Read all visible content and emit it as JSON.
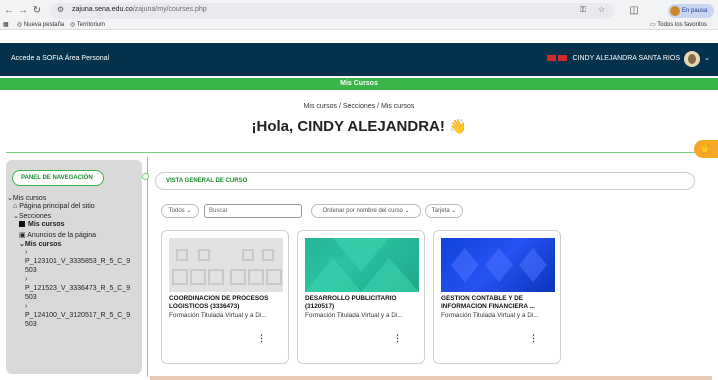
{
  "browser": {
    "url_host": "zajuna.sena.edu.co",
    "url_path": "/zajuna/my/courses.php",
    "pause_label": "En pausa",
    "bookmarks": [
      "Nueva pestaña",
      "Territorium"
    ],
    "all_bookmarks": "Todos los favoritos"
  },
  "header": {
    "left_links": "Accede a SOFIA   Área Personal",
    "user_name": "CINDY ALEJANDRA SANTA RIOS"
  },
  "banner": {
    "title": "Mis Cursos"
  },
  "breadcrumb": "Mis cursos / Secciones / Mis cursos",
  "greeting": "¡Hola, CINDY ALEJANDRA!",
  "wave_icon": "👋",
  "sidebar": {
    "panel_title": "PANEL DE NAVEGACIÓN",
    "items": [
      {
        "label": "Mis cursos"
      },
      {
        "label": "Página principal del sitio"
      },
      {
        "label": "Secciones"
      },
      {
        "label": "Mis cursos"
      },
      {
        "label": "Anuncios de la página"
      },
      {
        "label": "Mis cursos"
      },
      {
        "label": "P_123101_V_3335853_R_5_C_9"
      },
      {
        "label": "503"
      },
      {
        "label": "P_121523_V_3336473_R_5_C_9"
      },
      {
        "label": "503"
      },
      {
        "label": "P_124100_V_3120517_R_5_C_9"
      },
      {
        "label": "503"
      }
    ]
  },
  "overview": {
    "title": "VISTA GENERAL DE CURSO",
    "filter_all": "Todos",
    "search_placeholder": "Buscar",
    "sort_label": "Ordenar por nombre del curso",
    "view_label": "Tarjeta"
  },
  "courses": [
    {
      "title": "COORDINACION DE PROCESOS LOGISTICOS (3336473)",
      "subtitle": "Formación Titulada Virtual y a Di..."
    },
    {
      "title": "DESARROLLO PUBLICITARIO (3120517)",
      "subtitle": "Formación Titulada Virtual y a Di..."
    },
    {
      "title": "GESTION CONTABLE Y DE INFORMACION FINANCIERA ...",
      "subtitle": "Formación Titulada Virtual y a Di..."
    }
  ],
  "colors": {
    "header": "#04324d",
    "accent": "#39b54a"
  }
}
